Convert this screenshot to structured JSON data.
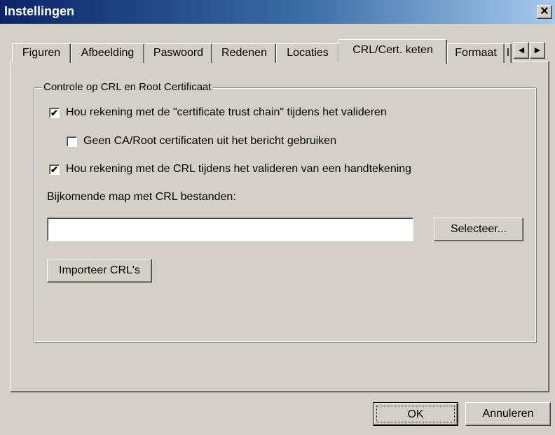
{
  "window": {
    "title": "Instellingen",
    "close_glyph": "✕"
  },
  "tabs": [
    {
      "label": "Figuren"
    },
    {
      "label": "Afbeelding"
    },
    {
      "label": "Paswoord"
    },
    {
      "label": "Redenen"
    },
    {
      "label": "Locaties"
    },
    {
      "label": "CRL/Cert. keten",
      "active": true
    },
    {
      "label": "Formaat"
    },
    {
      "label": "I"
    }
  ],
  "tab_scroll": {
    "left_glyph": "◀",
    "right_glyph": "▶"
  },
  "group": {
    "legend": "Controle op CRL en Root Certificaat",
    "checkbox_trust_chain": {
      "label": "Hou rekening met de \"certificate trust chain\" tijdens het valideren",
      "checked": true,
      "mark": "✔"
    },
    "checkbox_no_ca_root": {
      "label": "Geen CA/Root certificaten uit het bericht gebruiken",
      "checked": false,
      "mark": ""
    },
    "checkbox_crl": {
      "label": "Hou rekening met de CRL tijdens het valideren van een handtekening",
      "checked": true,
      "mark": "✔"
    },
    "crl_folder_label": "Bijkomende map met CRL bestanden:",
    "crl_folder_value": "",
    "select_button": "Selecteer...",
    "import_button": "Importeer CRL's"
  },
  "footer": {
    "ok_button": "OK",
    "cancel_button": "Annuleren"
  }
}
